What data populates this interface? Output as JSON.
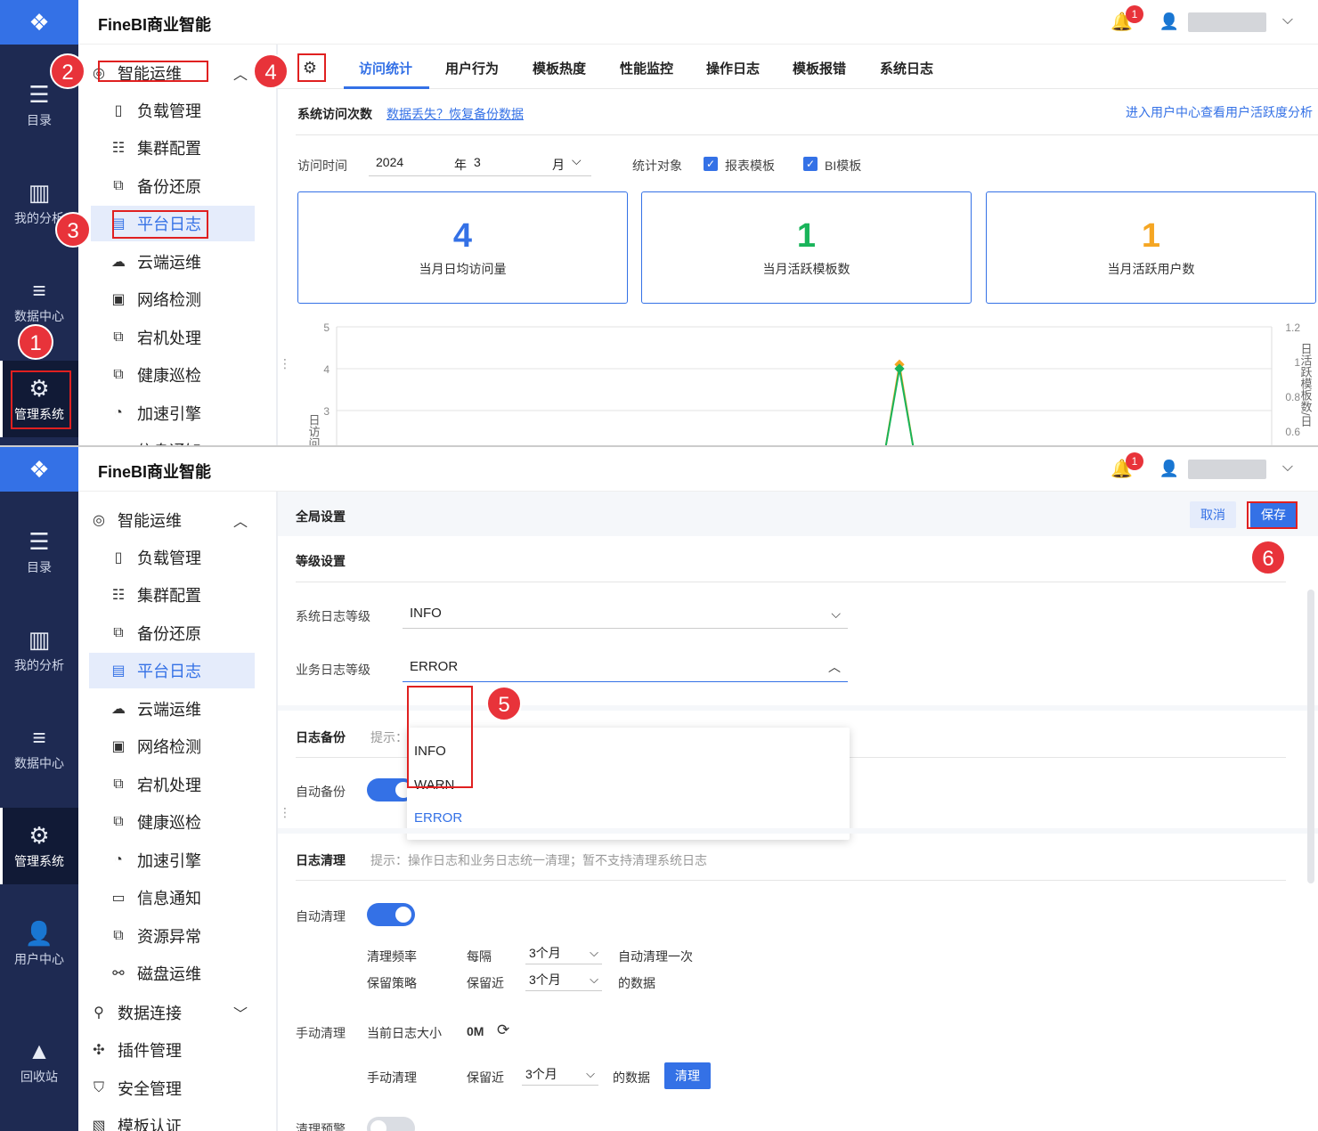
{
  "app": {
    "brand": "FineBI商业智能",
    "notification_count": "1"
  },
  "rail_top": [
    {
      "icon": "☰",
      "label": "目录"
    },
    {
      "icon": "▥",
      "label": "我的分析"
    },
    {
      "icon": "≡",
      "label": "数据中心"
    },
    {
      "icon": "⚙",
      "label": "管理系统"
    }
  ],
  "rail_bottom": [
    {
      "icon": "☰",
      "label": "目录"
    },
    {
      "icon": "▥",
      "label": "我的分析"
    },
    {
      "icon": "≡",
      "label": "数据中心"
    },
    {
      "icon": "⚙",
      "label": "管理系统"
    },
    {
      "icon": "👤",
      "label": "用户中心"
    },
    {
      "icon": "▲",
      "label": "回收站"
    }
  ],
  "menu_top": {
    "group": "智能运维",
    "items": [
      "负载管理",
      "集群配置",
      "备份还原",
      "平台日志",
      "云端运维",
      "网络检测",
      "宕机处理",
      "健康巡检",
      "加速引擎",
      "信息通知"
    ]
  },
  "menu_bottom": {
    "group": "智能运维",
    "items": [
      "负载管理",
      "集群配置",
      "备份还原",
      "平台日志",
      "云端运维",
      "网络检测",
      "宕机处理",
      "健康巡检",
      "加速引擎",
      "信息通知",
      "资源异常",
      "磁盘运维"
    ],
    "others": [
      "数据连接",
      "插件管理",
      "安全管理",
      "模板认证"
    ]
  },
  "steps": [
    "1",
    "2",
    "3",
    "4",
    "5",
    "6"
  ],
  "tabs": [
    "访问统计",
    "用户行为",
    "模板热度",
    "性能监控",
    "操作日志",
    "模板报错",
    "系统日志"
  ],
  "stats": {
    "section_title": "系统访问次数",
    "restore_link": "数据丢失？恢复备份数据",
    "user_center_link": "进入用户中心查看用户活跃度分析",
    "time_label": "访问时间",
    "year": "2024",
    "year_unit": "年",
    "month": "3",
    "month_unit": "月",
    "target_label": "统计对象",
    "check1": "报表模板",
    "check2": "BI模板",
    "cards": [
      {
        "value": "4",
        "label": "当月日均访问量",
        "color": "#3471e6"
      },
      {
        "value": "1",
        "label": "当月活跃模板数",
        "color": "#19b45a"
      },
      {
        "value": "1",
        "label": "当月活跃用户数",
        "color": "#f5a623"
      }
    ]
  },
  "chart_data": {
    "type": "line",
    "yaxis_left_ticks": [
      "5",
      "4",
      "3"
    ],
    "yaxis_right_ticks": [
      "1.2",
      "1",
      "0.8",
      "0.6"
    ],
    "ylabel_left": "日访问",
    "ylabel_right": "日活跃模板数/日",
    "series": [
      {
        "values": [
          4.1
        ],
        "color": "#f5a623"
      },
      {
        "values": [
          4.0
        ],
        "color": "#19b45a"
      }
    ]
  },
  "settings": {
    "title": "全局设置",
    "cancel": "取消",
    "save": "保存",
    "level_section": "等级设置",
    "sys_level_label": "系统日志等级",
    "sys_level": "INFO",
    "biz_level_label": "业务日志等级",
    "biz_level": "ERROR",
    "options": [
      "INFO",
      "WARN",
      "ERROR"
    ],
    "backup_section": "日志备份",
    "backup_tip": "提示：",
    "auto_backup": "自动备份",
    "clean_section": "日志清理",
    "clean_tip": "提示：操作日志和业务日志统一清理；暂不支持清理系统日志",
    "auto_clean": "自动清理",
    "freq_label": "清理频率",
    "every": "每隔",
    "freq_value": "3个月",
    "freq_suffix": "自动清理一次",
    "keep_label": "保留策略",
    "keep_recent": "保留近",
    "keep_value": "3个月",
    "keep_suffix": "的数据",
    "manual_label": "手动清理",
    "size_label": "当前日志大小",
    "size_value": "0M",
    "manual_sub": "手动清理",
    "manual_keep": "保留近",
    "manual_value": "3个月",
    "manual_suffix": "的数据",
    "clean_btn": "清理",
    "warn_label": "清理预警"
  }
}
